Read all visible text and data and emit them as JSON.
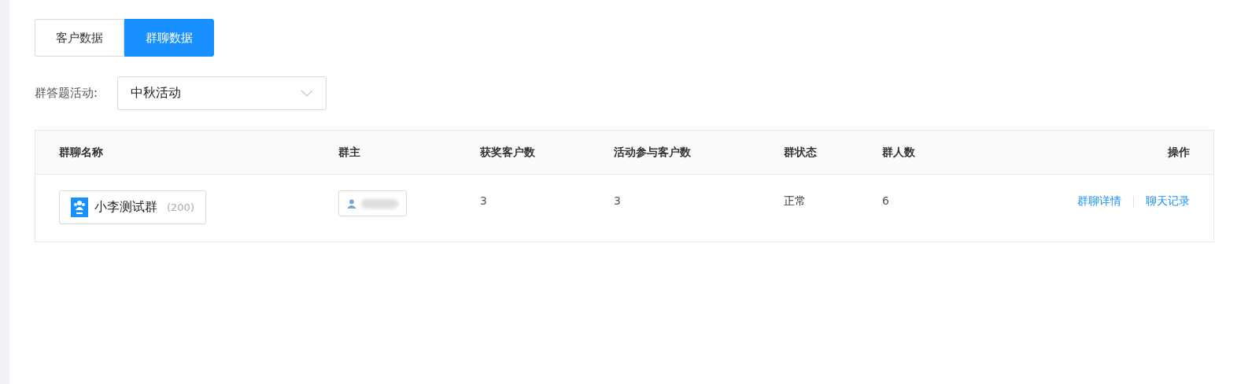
{
  "tabs": [
    {
      "label": "客户数据",
      "selected": false
    },
    {
      "label": "群聊数据",
      "selected": true
    }
  ],
  "filter": {
    "label": "群答题活动:",
    "value": "中秋活动"
  },
  "table": {
    "columns": [
      "群聊名称",
      "群主",
      "获奖客户数",
      "活动参与客户数",
      "群状态",
      "群人数",
      "操作"
    ],
    "rows": [
      {
        "group_name": "小李测试群",
        "group_count": "(200)",
        "awarded": "3",
        "participants": "3",
        "status": "正常",
        "members": "6",
        "actions": [
          "群聊详情",
          "聊天记录"
        ]
      }
    ]
  }
}
